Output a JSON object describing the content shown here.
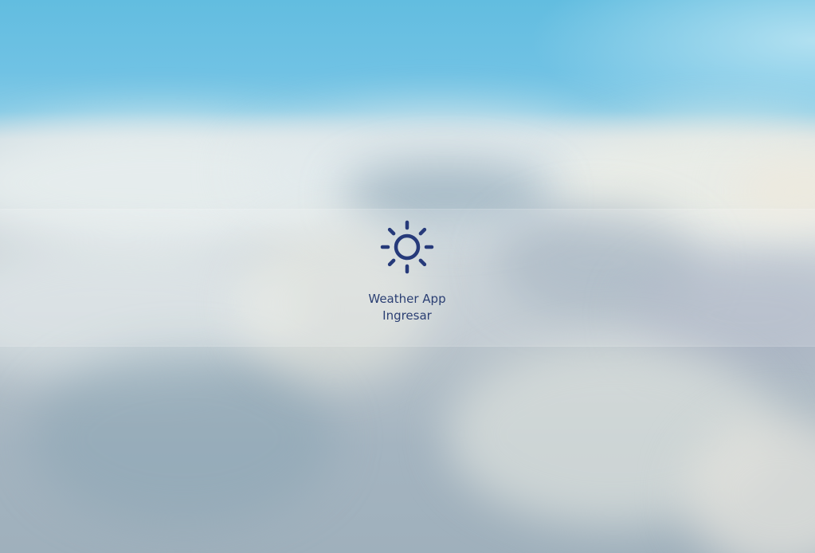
{
  "app": {
    "title": "Weather App",
    "login_label": "Ingresar",
    "logo_icon": "sun-icon"
  },
  "colors": {
    "accent": "#263a7a",
    "sky": "#66bfe2"
  }
}
